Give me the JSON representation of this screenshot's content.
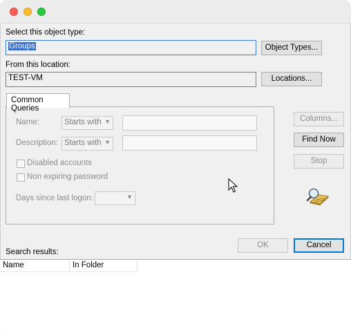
{
  "window": {
    "traffic_lights": [
      "close",
      "minimize",
      "maximize"
    ]
  },
  "object_type": {
    "label": "Select this object type:",
    "value": "Groups",
    "button": "Object Types..."
  },
  "location": {
    "label": "From this location:",
    "value": "TEST-VM",
    "button": "Locations..."
  },
  "common_queries": {
    "tab_label": "Common Queries",
    "name_label": "Name:",
    "name_mode": "Starts with",
    "description_label": "Description:",
    "description_mode": "Starts with",
    "disabled_accounts": "Disabled accounts",
    "non_expiring_password": "Non expiring password",
    "days_since_logon_label": "Days since last logon:"
  },
  "side_buttons": {
    "columns": "Columns...",
    "find_now": "Find Now",
    "stop": "Stop"
  },
  "dialog_buttons": {
    "ok": "OK",
    "cancel": "Cancel"
  },
  "results": {
    "label": "Search results:",
    "columns": [
      "Name",
      "In Folder"
    ]
  }
}
